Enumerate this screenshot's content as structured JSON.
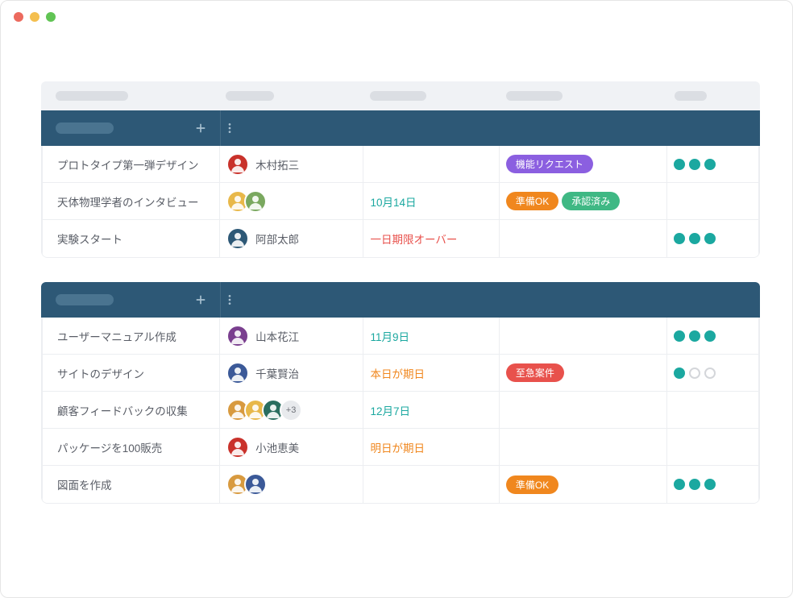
{
  "sections": [
    {
      "tasks": [
        {
          "name": "プロトタイプ第一弾デザイン",
          "assignees": [
            {
              "name": "木村拓三",
              "color": "#c9322b",
              "showName": true
            }
          ],
          "date": {
            "text": "",
            "style": ""
          },
          "tags": [
            {
              "text": "機能リクエスト",
              "color": "#8b5fe0"
            }
          ],
          "status": [
            "fill",
            "fill",
            "fill"
          ]
        },
        {
          "name": "天体物理学者のインタビュー",
          "assignees": [
            {
              "name": "",
              "color": "#e8b84a"
            },
            {
              "name": "",
              "color": "#7aa85f"
            }
          ],
          "date": {
            "text": "10月14日",
            "style": "teal"
          },
          "tags": [
            {
              "text": "準備OK",
              "color": "#f0871e"
            },
            {
              "text": "承認済み",
              "color": "#3fb884"
            }
          ],
          "status": []
        },
        {
          "name": "実験スタート",
          "assignees": [
            {
              "name": "阿部太郎",
              "color": "#2d5876",
              "showName": true
            }
          ],
          "date": {
            "text": "一日期限オーバー",
            "style": "red"
          },
          "tags": [],
          "status": [
            "fill",
            "fill",
            "fill"
          ]
        }
      ]
    },
    {
      "tasks": [
        {
          "name": "ユーザーマニュアル作成",
          "assignees": [
            {
              "name": "山本花江",
              "color": "#7a3f8f",
              "showName": true
            }
          ],
          "date": {
            "text": "11月9日",
            "style": "teal"
          },
          "tags": [],
          "status": [
            "fill",
            "fill",
            "fill"
          ]
        },
        {
          "name": "サイトのデザイン",
          "assignees": [
            {
              "name": "千葉賢治",
              "color": "#3b5998",
              "showName": true
            }
          ],
          "date": {
            "text": "本日が期日",
            "style": "orange"
          },
          "tags": [
            {
              "text": "至急案件",
              "color": "#e8514c"
            }
          ],
          "status": [
            "fill",
            "empty",
            "empty"
          ]
        },
        {
          "name": "顧客フィードバックの収集",
          "assignees": [
            {
              "name": "",
              "color": "#d89a3f"
            },
            {
              "name": "",
              "color": "#e8b84a"
            },
            {
              "name": "",
              "color": "#2a6e5f"
            }
          ],
          "moreCount": "+3",
          "date": {
            "text": "12月7日",
            "style": "teal"
          },
          "tags": [],
          "status": []
        },
        {
          "name": "パッケージを100販売",
          "assignees": [
            {
              "name": "小池恵美",
              "color": "#c9322b",
              "showName": true
            }
          ],
          "date": {
            "text": "明日が期日",
            "style": "orange"
          },
          "tags": [],
          "status": []
        },
        {
          "name": "図面を作成",
          "assignees": [
            {
              "name": "",
              "color": "#d89a3f"
            },
            {
              "name": "",
              "color": "#3b5998"
            }
          ],
          "date": {
            "text": "",
            "style": ""
          },
          "tags": [
            {
              "text": "準備OK",
              "color": "#f0871e"
            }
          ],
          "status": [
            "fill",
            "fill",
            "fill"
          ]
        }
      ]
    }
  ]
}
